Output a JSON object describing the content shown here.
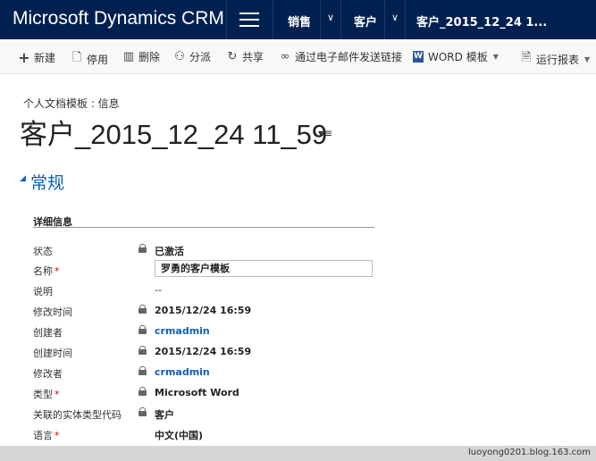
{
  "app_title": "Microsoft Dynamics CRM",
  "nav": {
    "crumbs": [
      "销售",
      "客户",
      "客户_2015_12_24 1..."
    ]
  },
  "commands": [
    {
      "label": "新建",
      "icon": "plus-icon"
    },
    {
      "label": "停用",
      "icon": "deactivate-icon"
    },
    {
      "label": "删除",
      "icon": "trash-icon"
    },
    {
      "label": "分派",
      "icon": "assign-icon"
    },
    {
      "label": "共享",
      "icon": "share-icon"
    },
    {
      "label": "通过电子邮件发送链接",
      "icon": "link-icon"
    },
    {
      "label": "WORD 模板",
      "icon": "word-icon"
    },
    {
      "label": "运行报表",
      "icon": "report-icon"
    }
  ],
  "header": {
    "entity_label": "个人文档模板 : 信息",
    "record_title": "客户_2015_12_24 11_59"
  },
  "section": {
    "title": "常规",
    "subheader": "详细信息"
  },
  "fields": [
    {
      "label": "状态",
      "required": false,
      "locked": true,
      "value": "已激活",
      "style": "bold"
    },
    {
      "label": "名称",
      "required": true,
      "locked": false,
      "value": "罗勇的客户模板",
      "style": "input"
    },
    {
      "label": "说明",
      "required": false,
      "locked": false,
      "value": "--",
      "style": "plain"
    },
    {
      "label": "修改时间",
      "required": false,
      "locked": true,
      "value": "2015/12/24   16:59",
      "style": "bold"
    },
    {
      "label": "创建者",
      "required": false,
      "locked": true,
      "value": "crmadmin",
      "style": "link"
    },
    {
      "label": "创建时间",
      "required": false,
      "locked": true,
      "value": "2015/12/24   16:59",
      "style": "bold"
    },
    {
      "label": "修改者",
      "required": false,
      "locked": true,
      "value": "crmadmin",
      "style": "link"
    },
    {
      "label": "类型",
      "required": true,
      "locked": true,
      "value": "Microsoft Word",
      "style": "bold"
    },
    {
      "label": "关联的实体类型代码",
      "required": false,
      "locked": true,
      "value": "客户",
      "style": "bold"
    },
    {
      "label": "语言",
      "required": true,
      "locked": false,
      "value": "中文(中国)",
      "style": "bold"
    }
  ],
  "watermark": "luoyong0201.blog.163.com"
}
